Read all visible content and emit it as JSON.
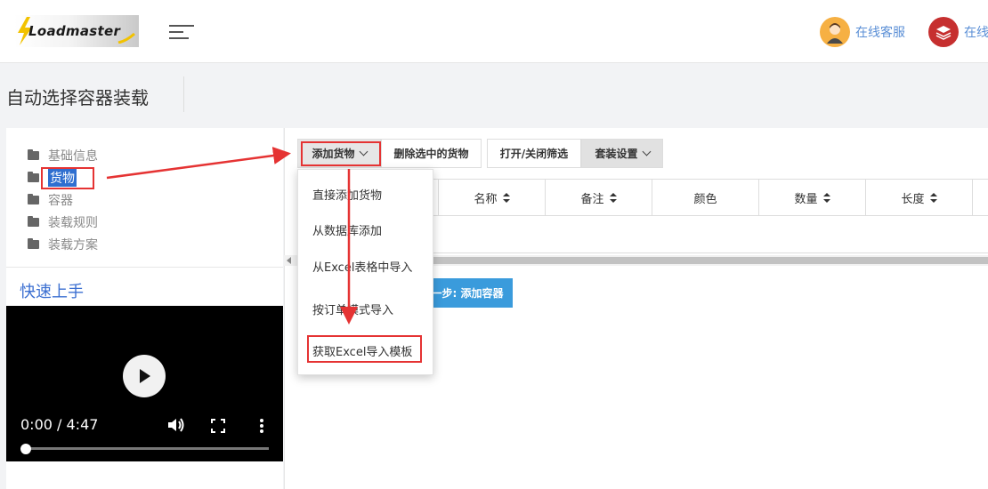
{
  "header": {
    "logo_text": "Loadmaster",
    "service_1_label": "在线客服",
    "service_2_label": "在线客"
  },
  "page": {
    "title": "自动选择容器装载"
  },
  "sidebar": {
    "items": [
      {
        "label": "基础信息"
      },
      {
        "label": "货物"
      },
      {
        "label": "容器"
      },
      {
        "label": "装载规则"
      },
      {
        "label": "装载方案"
      }
    ],
    "selected_index": 1
  },
  "quick_start": {
    "title": "快速上手",
    "video_time": "0:00 / 4:47",
    "progress_fraction": 0
  },
  "toolbar": {
    "add_cargo": "添加货物",
    "delete_selected": "删除选中的货物",
    "toggle_filter": "打开/关闭筛选",
    "packing_settings": "套装设置"
  },
  "table": {
    "columns": [
      "名称",
      "备注",
      "颜色",
      "数量",
      "长度"
    ]
  },
  "next_step_label": "一步: 添加容器",
  "dropdown": {
    "items": [
      "直接添加货物",
      "从数据库添加",
      "从Excel表格中导入",
      "按订单模式导入",
      "获取Excel导入模板"
    ]
  },
  "colors": {
    "accent": "#3a9bdc",
    "highlight_box": "#e53333",
    "link_blue": "#5b8fd6"
  }
}
